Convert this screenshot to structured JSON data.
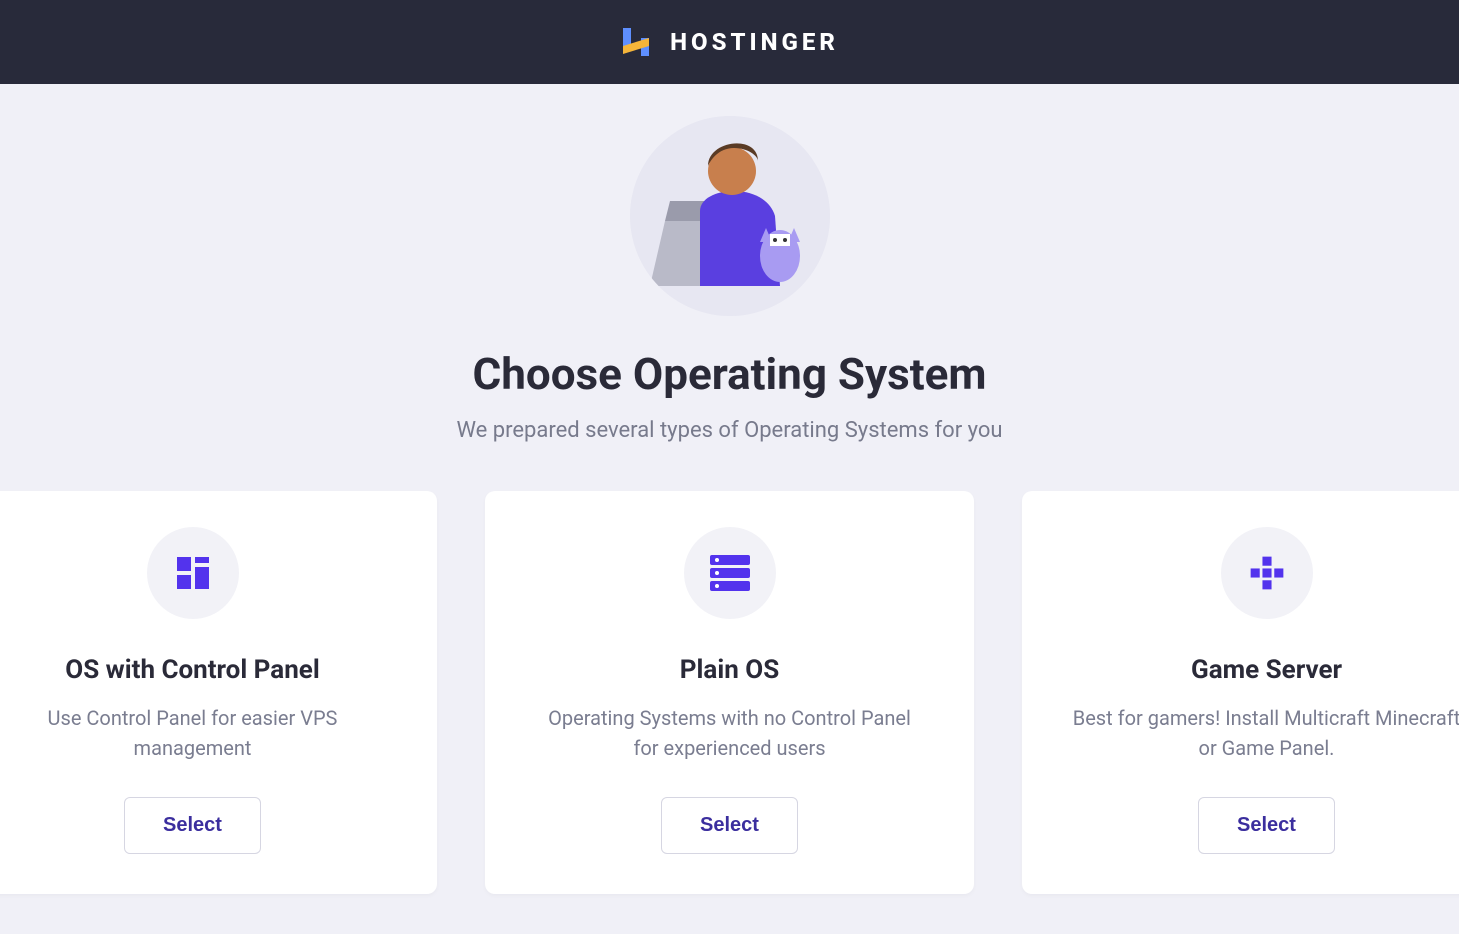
{
  "header": {
    "brand": "HOSTINGER"
  },
  "hero": {
    "title": "Choose Operating System",
    "subtitle": "We prepared several types of Operating Systems for you"
  },
  "cards": [
    {
      "icon": "dashboard-icon",
      "title": "OS with Control Panel",
      "desc": "Use Control Panel for easier VPS management",
      "button": "Select"
    },
    {
      "icon": "server-icon",
      "title": "Plain OS",
      "desc": "Operating Systems with no Control Panel for experienced users",
      "button": "Select"
    },
    {
      "icon": "gamepad-icon",
      "title": "Game Server",
      "desc": "Best for gamers! Install Multicraft Minecraft or Game Panel.",
      "button": "Select"
    }
  ],
  "colors": {
    "accent": "#5333ed",
    "topbar": "#282a3a",
    "page_bg": "#f0f0f7"
  }
}
